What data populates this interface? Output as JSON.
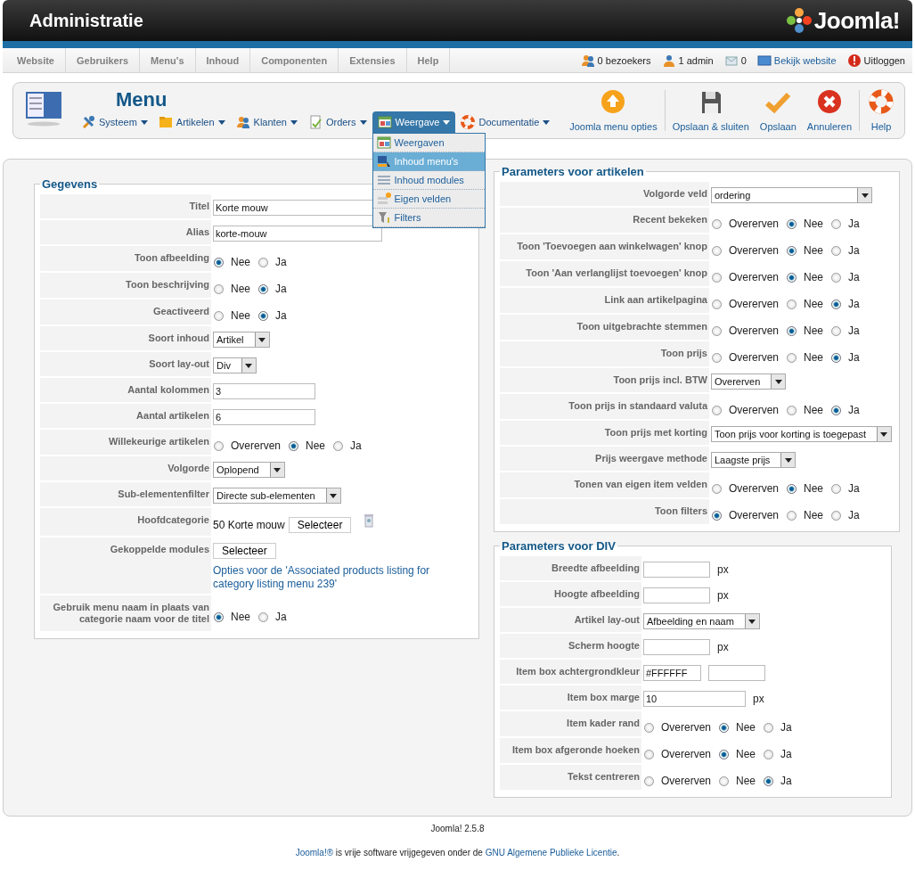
{
  "header": {
    "title": "Administratie",
    "logo": "Joomla!"
  },
  "nav": [
    {
      "label": "Website"
    },
    {
      "label": "Gebruikers"
    },
    {
      "label": "Menu's"
    },
    {
      "label": "Inhoud"
    },
    {
      "label": "Componenten"
    },
    {
      "label": "Extensies"
    },
    {
      "label": "Help"
    }
  ],
  "status": [
    {
      "label": "0 bezoekers",
      "link": false
    },
    {
      "label": "1 admin",
      "link": false
    },
    {
      "label": "0",
      "link": false
    },
    {
      "label": "Bekijk website",
      "link": true
    },
    {
      "label": "Uitloggen",
      "link": false
    }
  ],
  "toolbar": {
    "title": "Menu",
    "submenus": [
      {
        "label": "Systeem",
        "selected": false
      },
      {
        "label": "Artikelen",
        "selected": false
      },
      {
        "label": "Klanten",
        "selected": false
      },
      {
        "label": "Orders",
        "selected": false
      },
      {
        "label": "Weergave",
        "selected": true
      },
      {
        "label": "Documentatie",
        "selected": false
      }
    ],
    "dropdown": [
      {
        "label": "Weergaven",
        "selected": false
      },
      {
        "label": "Inhoud menu's",
        "selected": true
      },
      {
        "label": "Inhoud modules",
        "selected": false
      },
      {
        "label": "Eigen velden",
        "selected": false
      },
      {
        "label": "Filters",
        "selected": false
      }
    ],
    "actions": [
      {
        "label": "Joomla menu opties"
      },
      {
        "label": "Opslaan & sluiten"
      },
      {
        "label": "Opslaan"
      },
      {
        "label": "Annuleren"
      },
      {
        "label": "Help"
      }
    ]
  },
  "panels": [
    {
      "legend": "Gegevens",
      "fields": [
        {
          "label": "Titel",
          "kind": "text",
          "value": "Korte mouw"
        },
        {
          "label": "Alias",
          "kind": "text",
          "value": "korte-mouw"
        },
        {
          "label": "Toon afbeelding",
          "kind": "radio",
          "options": [
            {
              "label": "Nee",
              "selected": true
            },
            {
              "label": "Ja",
              "selected": false
            }
          ]
        },
        {
          "label": "Toon beschrijving",
          "kind": "radio",
          "options": [
            {
              "label": "Nee",
              "selected": false
            },
            {
              "label": "Ja",
              "selected": true
            }
          ]
        },
        {
          "label": "Geactiveerd",
          "kind": "radio",
          "options": [
            {
              "label": "Nee",
              "selected": false
            },
            {
              "label": "Ja",
              "selected": true
            }
          ]
        },
        {
          "label": "Soort inhoud",
          "kind": "select",
          "value": "Artikel"
        },
        {
          "label": "Soort lay-out",
          "kind": "select",
          "value": "Div"
        },
        {
          "label": "Aantal kolommen",
          "kind": "short",
          "value": "3"
        },
        {
          "label": "Aantal artikelen",
          "kind": "short",
          "value": "6"
        },
        {
          "label": "Willekeurige artikelen",
          "kind": "radio",
          "options": [
            {
              "label": "Overerven",
              "selected": false
            },
            {
              "label": "Nee",
              "selected": true
            },
            {
              "label": "Ja",
              "selected": false
            }
          ]
        },
        {
          "label": "Volgorde",
          "kind": "select",
          "value": "Oplopend"
        },
        {
          "label": "Sub-elementenfilter",
          "kind": "select",
          "value": "Directe sub-elementen"
        },
        {
          "label": "Hoofdcategorie",
          "kind": "category",
          "value": "50 Korte mouw",
          "button": "Selecteer"
        },
        {
          "label": "Gekoppelde modules",
          "kind": "modules",
          "button": "Selecteer",
          "note": "Opties voor de 'Associated products listing for category listing menu 239'"
        },
        {
          "label": "Gebruik menu naam in plaats van categorie naam voor de titel",
          "kind": "radio",
          "options": [
            {
              "label": "Nee",
              "selected": true
            },
            {
              "label": "Ja",
              "selected": false
            }
          ]
        }
      ]
    },
    {
      "legend": "Parameters voor artikelen",
      "fields": [
        {
          "label": "Volgorde veld",
          "kind": "select-wide",
          "value": "ordering"
        },
        {
          "label": "Recent bekeken",
          "kind": "radio",
          "options": [
            {
              "label": "Overerven",
              "selected": false
            },
            {
              "label": "Nee",
              "selected": true
            },
            {
              "label": "Ja",
              "selected": false
            }
          ]
        },
        {
          "label": "Toon 'Toevoegen aan winkelwagen' knop",
          "kind": "radio",
          "options": [
            {
              "label": "Overerven",
              "selected": false
            },
            {
              "label": "Nee",
              "selected": true
            },
            {
              "label": "Ja",
              "selected": false
            }
          ]
        },
        {
          "label": "Toon 'Aan verlanglijst toevoegen' knop",
          "kind": "radio",
          "options": [
            {
              "label": "Overerven",
              "selected": false
            },
            {
              "label": "Nee",
              "selected": true
            },
            {
              "label": "Ja",
              "selected": false
            }
          ]
        },
        {
          "label": "Link aan artikelpagina",
          "kind": "radio",
          "options": [
            {
              "label": "Overerven",
              "selected": false
            },
            {
              "label": "Nee",
              "selected": false
            },
            {
              "label": "Ja",
              "selected": true
            }
          ]
        },
        {
          "label": "Toon uitgebrachte stemmen",
          "kind": "radio",
          "options": [
            {
              "label": "Overerven",
              "selected": false
            },
            {
              "label": "Nee",
              "selected": true
            },
            {
              "label": "Ja",
              "selected": false
            }
          ]
        },
        {
          "label": "Toon prijs",
          "kind": "radio",
          "options": [
            {
              "label": "Overerven",
              "selected": false
            },
            {
              "label": "Nee",
              "selected": false
            },
            {
              "label": "Ja",
              "selected": true
            }
          ]
        },
        {
          "label": "Toon prijs incl. BTW",
          "kind": "select",
          "value": "Overerven"
        },
        {
          "label": "Toon prijs in standaard valuta",
          "kind": "radio",
          "options": [
            {
              "label": "Overerven",
              "selected": false
            },
            {
              "label": "Nee",
              "selected": false
            },
            {
              "label": "Ja",
              "selected": true
            }
          ]
        },
        {
          "label": "Toon prijs met korting",
          "kind": "select",
          "value": "Toon prijs voor korting is toegepast"
        },
        {
          "label": "Prijs weergave methode",
          "kind": "select",
          "value": "Laagste prijs"
        },
        {
          "label": "Tonen van eigen item velden",
          "kind": "radio",
          "options": [
            {
              "label": "Overerven",
              "selected": false
            },
            {
              "label": "Nee",
              "selected": true
            },
            {
              "label": "Ja",
              "selected": false
            }
          ]
        },
        {
          "label": "Toon filters",
          "kind": "radio",
          "options": [
            {
              "label": "Overerven",
              "selected": true
            },
            {
              "label": "Nee",
              "selected": false
            },
            {
              "label": "Ja",
              "selected": false
            }
          ]
        }
      ]
    },
    {
      "legend": "Parameters voor DIV",
      "fields": [
        {
          "label": "Breedte afbeelding",
          "kind": "px",
          "unit": "px"
        },
        {
          "label": "Hoogte afbeelding",
          "kind": "px",
          "unit": "px"
        },
        {
          "label": "Artikel lay-out",
          "kind": "select",
          "value": "Afbeelding en naam"
        },
        {
          "label": "Scherm hoogte",
          "kind": "px",
          "unit": "px"
        },
        {
          "label": "Item box achtergrondkleur",
          "kind": "color",
          "value": "#FFFFFF"
        },
        {
          "label": "Item box marge",
          "kind": "px-wide",
          "value": "10",
          "unit": "px"
        },
        {
          "label": "Item kader rand",
          "kind": "radio",
          "options": [
            {
              "label": "Overerven",
              "selected": false
            },
            {
              "label": "Nee",
              "selected": true
            },
            {
              "label": "Ja",
              "selected": false
            }
          ]
        },
        {
          "label": "Item box afgeronde hoeken",
          "kind": "radio",
          "options": [
            {
              "label": "Overerven",
              "selected": false
            },
            {
              "label": "Nee",
              "selected": true
            },
            {
              "label": "Ja",
              "selected": false
            }
          ]
        },
        {
          "label": "Tekst centreren",
          "kind": "radio",
          "options": [
            {
              "label": "Overerven",
              "selected": false
            },
            {
              "label": "Nee",
              "selected": false
            },
            {
              "label": "Ja",
              "selected": true
            }
          ]
        }
      ]
    }
  ],
  "footer": {
    "version": "Joomla! 2.5.8",
    "license": [
      {
        "text": "Joomla!®",
        "link": true
      },
      {
        "text": " is vrije software vrijgegeven onder de ",
        "link": false
      },
      {
        "text": "GNU Algemene Publieke Licentie",
        "link": true
      },
      {
        "text": ".",
        "link": false
      }
    ]
  }
}
